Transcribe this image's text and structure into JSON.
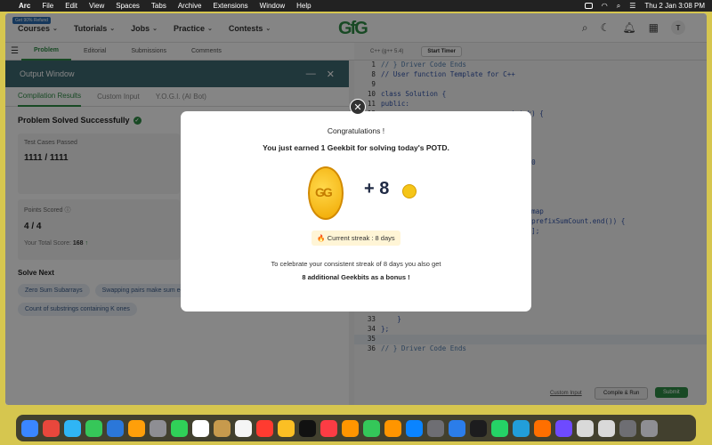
{
  "menubar": {
    "app_name": "Arc",
    "menus": [
      "File",
      "Edit",
      "View",
      "Spaces",
      "Tabs",
      "Archive",
      "Extensions",
      "Window",
      "Help"
    ],
    "datetime": "Thu 2 Jan  3:08 PM"
  },
  "site_nav": {
    "badge": "Get 90% Refund",
    "items": [
      {
        "label": "Courses"
      },
      {
        "label": "Tutorials"
      },
      {
        "label": "Jobs"
      },
      {
        "label": "Practice"
      },
      {
        "label": "Contests"
      }
    ],
    "logo": "GfG",
    "avatar_initial": "T"
  },
  "problem_tabs": [
    {
      "label": "Problem",
      "active": true
    },
    {
      "label": "Editorial"
    },
    {
      "label": "Submissions"
    },
    {
      "label": "Comments"
    }
  ],
  "output_window": {
    "title": "Output Window",
    "tabs": [
      {
        "label": "Compilation Results",
        "active": true
      },
      {
        "label": "Custom Input"
      },
      {
        "label": "Y.O.G.I. (AI Bot)"
      }
    ],
    "status": "Problem Solved Successfully",
    "test_cases_label": "Test Cases Passed",
    "test_cases_value": "1111 / 1111",
    "points_label": "Points Scored",
    "points_value": "4 / 4",
    "total_score_label": "Your Total Score:",
    "total_score_value": "168",
    "solve_next_label": "Solve Next",
    "solve_next": [
      "Zero Sum Subarrays",
      "Swapping pairs make sum equal",
      "Count of substrings containing K ones"
    ]
  },
  "editor": {
    "language": "C++ (g++ 5.4)",
    "timer_label": "Start Timer",
    "lines": [
      {
        "n": "1",
        "text": "// } Driver Code Ends",
        "hl": true
      },
      {
        "n": "8",
        "text": "// User function Template for C++"
      },
      {
        "n": "9",
        "text": ""
      },
      {
        "n": "10",
        "text": "class Solution {"
      },
      {
        "n": "11",
        "text": "public:"
      },
      {
        "n": "12",
        "text": "                              , int k) {"
      },
      {
        "n": "13",
        "text": ""
      },
      {
        "n": "14",
        "text": "                        ixSumCount;"
      },
      {
        "n": "15",
        "text": "                        0;"
      },
      {
        "n": "16",
        "text": ""
      },
      {
        "n": "17",
        "text": "                        unt with sum 0"
      },
      {
        "n": "18",
        "text": ""
      },
      {
        "n": "19",
        "text": "                        {"
      },
      {
        "n": "20",
        "text": ""
      },
      {
        "n": "21",
        "text": ""
      },
      {
        "n": "22",
        "text": "                  - k) exists in the map"
      },
      {
        "n": "23",
        "text": "                  currentSum - k) != prefixSumCount.end()) {"
      },
      {
        "n": "24",
        "text": "                  ount[currentSum - k];"
      },
      {
        "n": "25",
        "text": ""
      },
      {
        "n": "26",
        "text": ""
      },
      {
        "n": "27",
        "text": "                  efixSumCount"
      },
      {
        "n": "28",
        "text": "                  um]++;"
      },
      {
        "n": "29",
        "text": ""
      },
      {
        "n": "30",
        "text": ""
      },
      {
        "n": "31",
        "text": ""
      },
      {
        "n": "32",
        "text": ""
      },
      {
        "n": "33",
        "text": "    }"
      },
      {
        "n": "34",
        "text": "};"
      },
      {
        "n": "35",
        "text": "",
        "cur": true
      },
      {
        "n": "36",
        "text": "// } Driver Code Ends",
        "hl": true
      }
    ],
    "custom_input": "Custom Input",
    "compile_run": "Compile & Run",
    "submit": "Submit"
  },
  "modal": {
    "title": "Congratulations !",
    "subtitle": "You just earned 1 Geekbit for solving today's POTD.",
    "reward": "+ 8",
    "coin_mark": "GG",
    "streak": "🔥 Current streak : 8 days",
    "footer_line1": "To celebrate your consistent streak of 8 days you also get",
    "footer_line2": "8 additional Geekbits as a bonus !",
    "close": "✕"
  },
  "dock": {
    "colors": [
      "#3a86ff",
      "#e8473c",
      "#2fb5f5",
      "#36c759",
      "#2b77d9",
      "#ff9f0a",
      "#8e8e93",
      "#30d158",
      "#ffffff",
      "#c79a4d",
      "#f5f5f5",
      "#ff3b30",
      "#fbbf24",
      "#111111",
      "#fc3c44",
      "#ff9500",
      "#34c759",
      "#ff9500",
      "#0a84ff",
      "#6e6e73",
      "#2b7de9",
      "#1c1c1e",
      "#25d366",
      "#229ed9",
      "#ff6f00",
      "#6e4aff",
      "#d9d9d9",
      "#d9d9d9",
      "#6e6e73",
      "#8e8e93"
    ]
  }
}
